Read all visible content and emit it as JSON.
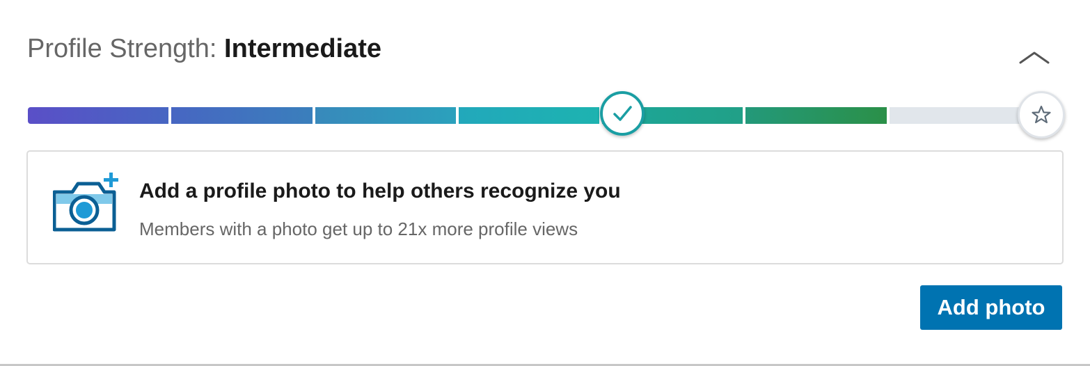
{
  "header": {
    "label": "Profile Strength:",
    "level": "Intermediate"
  },
  "collapse_icon": "chevron-up-icon",
  "meter": {
    "current_step": 4,
    "total_steps": 7,
    "segment_colors": [
      [
        "#5a4fc7",
        "#4766c2"
      ],
      [
        "#4766c2",
        "#3a7fbc"
      ],
      [
        "#3889bb",
        "#2ba1bc"
      ],
      [
        "#22a8bb",
        "#1db3b0"
      ],
      [
        "#1ca79a",
        "#21a087"
      ],
      [
        "#23997a",
        "#2b9048"
      ],
      [
        "#e1e6eb",
        "#e1e6eb"
      ]
    ],
    "completed_marker_icon": "checkmark-icon",
    "goal_marker_icon": "star-icon"
  },
  "suggestion": {
    "icon": "camera-add-icon",
    "headline": "Add a profile photo to help others recognize you",
    "subtext": "Members with a photo get up to 21x more profile views"
  },
  "action": {
    "button_label": "Add photo",
    "button_color": "#0073b1"
  }
}
